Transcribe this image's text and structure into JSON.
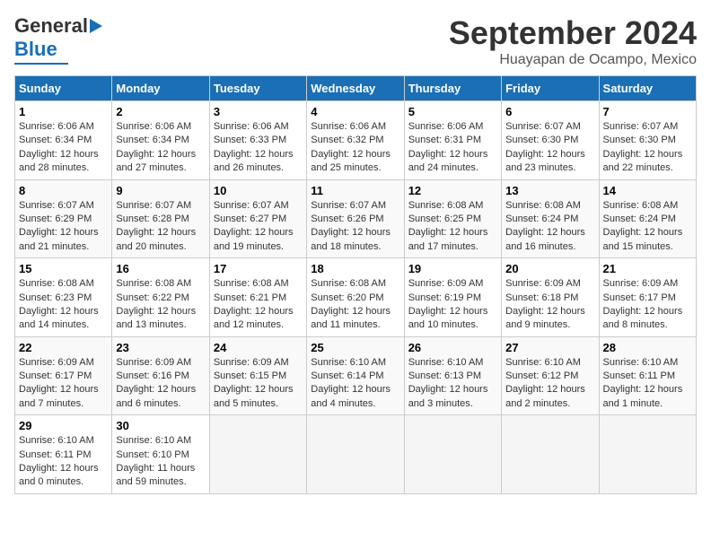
{
  "header": {
    "logo_line1": "General",
    "logo_line2": "Blue",
    "title": "September 2024",
    "subtitle": "Huayapan de Ocampo, Mexico"
  },
  "calendar": {
    "days_of_week": [
      "Sunday",
      "Monday",
      "Tuesday",
      "Wednesday",
      "Thursday",
      "Friday",
      "Saturday"
    ],
    "weeks": [
      [
        null,
        {
          "day": 2,
          "sunrise": "6:06 AM",
          "sunset": "6:34 PM",
          "daylight": "12 hours and 27 minutes."
        },
        {
          "day": 3,
          "sunrise": "6:06 AM",
          "sunset": "6:33 PM",
          "daylight": "12 hours and 26 minutes."
        },
        {
          "day": 4,
          "sunrise": "6:06 AM",
          "sunset": "6:32 PM",
          "daylight": "12 hours and 25 minutes."
        },
        {
          "day": 5,
          "sunrise": "6:06 AM",
          "sunset": "6:31 PM",
          "daylight": "12 hours and 24 minutes."
        },
        {
          "day": 6,
          "sunrise": "6:07 AM",
          "sunset": "6:30 PM",
          "daylight": "12 hours and 23 minutes."
        },
        {
          "day": 7,
          "sunrise": "6:07 AM",
          "sunset": "6:30 PM",
          "daylight": "12 hours and 22 minutes."
        }
      ],
      [
        {
          "day": 1,
          "sunrise": "6:06 AM",
          "sunset": "6:34 PM",
          "daylight": "12 hours and 28 minutes."
        },
        {
          "day": 8,
          "sunrise": "6:07 AM",
          "sunset": "6:29 PM",
          "daylight": "12 hours and 21 minutes."
        },
        {
          "day": 9,
          "sunrise": "6:07 AM",
          "sunset": "6:28 PM",
          "daylight": "12 hours and 20 minutes."
        },
        {
          "day": 10,
          "sunrise": "6:07 AM",
          "sunset": "6:27 PM",
          "daylight": "12 hours and 19 minutes."
        },
        {
          "day": 11,
          "sunrise": "6:07 AM",
          "sunset": "6:26 PM",
          "daylight": "12 hours and 18 minutes."
        },
        {
          "day": 12,
          "sunrise": "6:08 AM",
          "sunset": "6:25 PM",
          "daylight": "12 hours and 17 minutes."
        },
        {
          "day": 13,
          "sunrise": "6:08 AM",
          "sunset": "6:24 PM",
          "daylight": "12 hours and 16 minutes."
        },
        {
          "day": 14,
          "sunrise": "6:08 AM",
          "sunset": "6:24 PM",
          "daylight": "12 hours and 15 minutes."
        }
      ],
      [
        {
          "day": 15,
          "sunrise": "6:08 AM",
          "sunset": "6:23 PM",
          "daylight": "12 hours and 14 minutes."
        },
        {
          "day": 16,
          "sunrise": "6:08 AM",
          "sunset": "6:22 PM",
          "daylight": "12 hours and 13 minutes."
        },
        {
          "day": 17,
          "sunrise": "6:08 AM",
          "sunset": "6:21 PM",
          "daylight": "12 hours and 12 minutes."
        },
        {
          "day": 18,
          "sunrise": "6:08 AM",
          "sunset": "6:20 PM",
          "daylight": "12 hours and 11 minutes."
        },
        {
          "day": 19,
          "sunrise": "6:09 AM",
          "sunset": "6:19 PM",
          "daylight": "12 hours and 10 minutes."
        },
        {
          "day": 20,
          "sunrise": "6:09 AM",
          "sunset": "6:18 PM",
          "daylight": "12 hours and 9 minutes."
        },
        {
          "day": 21,
          "sunrise": "6:09 AM",
          "sunset": "6:17 PM",
          "daylight": "12 hours and 8 minutes."
        }
      ],
      [
        {
          "day": 22,
          "sunrise": "6:09 AM",
          "sunset": "6:17 PM",
          "daylight": "12 hours and 7 minutes."
        },
        {
          "day": 23,
          "sunrise": "6:09 AM",
          "sunset": "6:16 PM",
          "daylight": "12 hours and 6 minutes."
        },
        {
          "day": 24,
          "sunrise": "6:09 AM",
          "sunset": "6:15 PM",
          "daylight": "12 hours and 5 minutes."
        },
        {
          "day": 25,
          "sunrise": "6:10 AM",
          "sunset": "6:14 PM",
          "daylight": "12 hours and 4 minutes."
        },
        {
          "day": 26,
          "sunrise": "6:10 AM",
          "sunset": "6:13 PM",
          "daylight": "12 hours and 3 minutes."
        },
        {
          "day": 27,
          "sunrise": "6:10 AM",
          "sunset": "6:12 PM",
          "daylight": "12 hours and 2 minutes."
        },
        {
          "day": 28,
          "sunrise": "6:10 AM",
          "sunset": "6:11 PM",
          "daylight": "12 hours and 1 minute."
        }
      ],
      [
        {
          "day": 29,
          "sunrise": "6:10 AM",
          "sunset": "6:11 PM",
          "daylight": "12 hours and 0 minutes."
        },
        {
          "day": 30,
          "sunrise": "6:10 AM",
          "sunset": "6:10 PM",
          "daylight": "11 hours and 59 minutes."
        },
        null,
        null,
        null,
        null,
        null
      ]
    ]
  }
}
